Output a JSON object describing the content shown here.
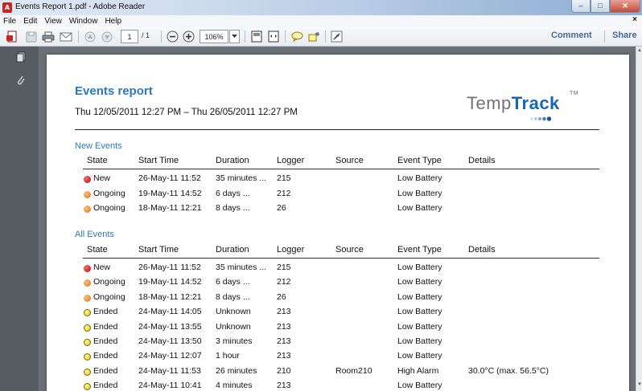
{
  "window": {
    "title": "Events Report 1.pdf - Adobe Reader",
    "app_icon_letter": "A",
    "controls": {
      "minimize": "–",
      "maximize": "□",
      "close": "✕"
    }
  },
  "menubar": {
    "items": [
      "File",
      "Edit",
      "View",
      "Window",
      "Help"
    ],
    "close_glyph": "×"
  },
  "toolbar": {
    "page_current": "1",
    "page_total": "/ 1",
    "zoom": "106%",
    "comment_label": "Comment",
    "share_label": "Share"
  },
  "report": {
    "title": "Events report",
    "date_range": "Thu 12/05/2011 12:27 PM – Thu 26/05/2011 12:27 PM",
    "logo_light": "Temp",
    "logo_bold": "Track",
    "logo_tm": "TM"
  },
  "columns": [
    "State",
    "Start Time",
    "Duration",
    "Logger",
    "Source",
    "Event Type",
    "Details"
  ],
  "new_events": {
    "title": "New Events",
    "rows": [
      {
        "state": "New",
        "status": "new",
        "start": "26-May-11 11:52",
        "duration": "35 minutes ...",
        "logger": "215",
        "source": "",
        "type": "Low Battery",
        "details": ""
      },
      {
        "state": "Ongoing",
        "status": "ongoing",
        "start": "19-May-11 14:52",
        "duration": "6 days ...",
        "logger": "212",
        "source": "",
        "type": "Low Battery",
        "details": ""
      },
      {
        "state": "Ongoing",
        "status": "ongoing",
        "start": "18-May-11 12:21",
        "duration": "8 days ...",
        "logger": "26",
        "source": "",
        "type": "Low Battery",
        "details": ""
      }
    ]
  },
  "all_events": {
    "title": "All Events",
    "rows": [
      {
        "state": "New",
        "status": "new",
        "start": "26-May-11 11:52",
        "duration": "35 minutes ...",
        "logger": "215",
        "source": "",
        "type": "Low Battery",
        "details": ""
      },
      {
        "state": "Ongoing",
        "status": "ongoing",
        "start": "19-May-11 14:52",
        "duration": "6 days ...",
        "logger": "212",
        "source": "",
        "type": "Low Battery",
        "details": ""
      },
      {
        "state": "Ongoing",
        "status": "ongoing",
        "start": "18-May-11 12:21",
        "duration": "8 days ...",
        "logger": "26",
        "source": "",
        "type": "Low Battery",
        "details": ""
      },
      {
        "state": "Ended",
        "status": "ended",
        "start": "24-May-11 14:05",
        "duration": "Unknown",
        "logger": "213",
        "source": "",
        "type": "Low Battery",
        "details": ""
      },
      {
        "state": "Ended",
        "status": "ended",
        "start": "24-May-11 13:55",
        "duration": "Unknown",
        "logger": "213",
        "source": "",
        "type": "Low Battery",
        "details": ""
      },
      {
        "state": "Ended",
        "status": "ended",
        "start": "24-May-11 13:50",
        "duration": "3 minutes",
        "logger": "213",
        "source": "",
        "type": "Low Battery",
        "details": ""
      },
      {
        "state": "Ended",
        "status": "ended",
        "start": "24-May-11 12:07",
        "duration": "1 hour",
        "logger": "213",
        "source": "",
        "type": "Low Battery",
        "details": ""
      },
      {
        "state": "Ended",
        "status": "ended",
        "start": "24-May-11 11:53",
        "duration": "26 minutes",
        "logger": "210",
        "source": "Room210",
        "type": "High Alarm",
        "details": "30.0°C (max. 56.5°C)"
      },
      {
        "state": "Ended",
        "status": "ended",
        "start": "24-May-11 10:41",
        "duration": "4 minutes",
        "logger": "213",
        "source": "",
        "type": "Low Battery",
        "details": ""
      }
    ]
  },
  "colors": {
    "heading_blue": "#2a78be",
    "new": "#c00000",
    "ongoing": "#d2781e",
    "ended": "#e6c800"
  }
}
